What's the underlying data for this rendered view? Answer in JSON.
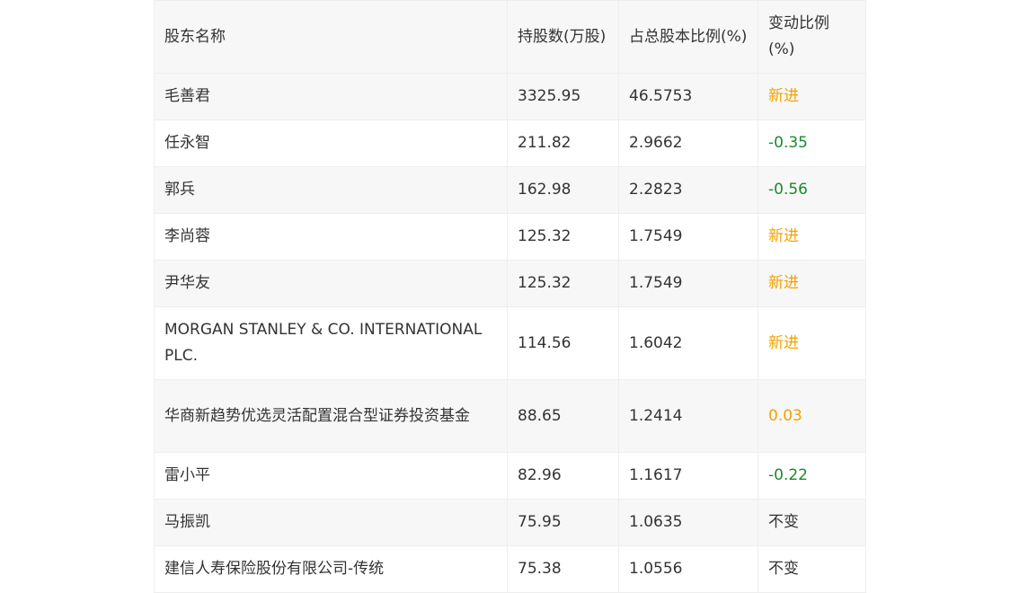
{
  "table": {
    "headers": [
      "股东名称",
      "持股数(万股)",
      "占总股本比例(%)",
      "变动比例(%)"
    ],
    "rows": [
      {
        "name": "毛善君",
        "shares": "3325.95",
        "ratio": "46.5753",
        "change": "新进",
        "change_type": "new"
      },
      {
        "name": "任永智",
        "shares": "211.82",
        "ratio": "2.9662",
        "change": "-0.35",
        "change_type": "down"
      },
      {
        "name": "郭兵",
        "shares": "162.98",
        "ratio": "2.2823",
        "change": "-0.56",
        "change_type": "down"
      },
      {
        "name": "李尚蓉",
        "shares": "125.32",
        "ratio": "1.7549",
        "change": "新进",
        "change_type": "new"
      },
      {
        "name": "尹华友",
        "shares": "125.32",
        "ratio": "1.7549",
        "change": "新进",
        "change_type": "new"
      },
      {
        "name": "MORGAN STANLEY & CO. INTERNATIONAL PLC.",
        "shares": "114.56",
        "ratio": "1.6042",
        "change": "新进",
        "change_type": "new"
      },
      {
        "name": "华商新趋势优选灵活配置混合型证券投资基金",
        "shares": "88.65",
        "ratio": "1.2414",
        "change": "0.03",
        "change_type": "up"
      },
      {
        "name": "雷小平",
        "shares": "82.96",
        "ratio": "1.1617",
        "change": "-0.22",
        "change_type": "down"
      },
      {
        "name": "马振凯",
        "shares": "75.95",
        "ratio": "1.0635",
        "change": "不变",
        "change_type": "same"
      },
      {
        "name": "建信人寿保险股份有限公司-传统",
        "shares": "75.38",
        "ratio": "1.0556",
        "change": "不变",
        "change_type": "same"
      }
    ]
  },
  "colors": {
    "new": "#f2a200",
    "up": "#f2a200",
    "down": "#1a8a2a",
    "same": "#333333",
    "header_bg": "#f7f7f7",
    "border": "#eeeeee"
  }
}
